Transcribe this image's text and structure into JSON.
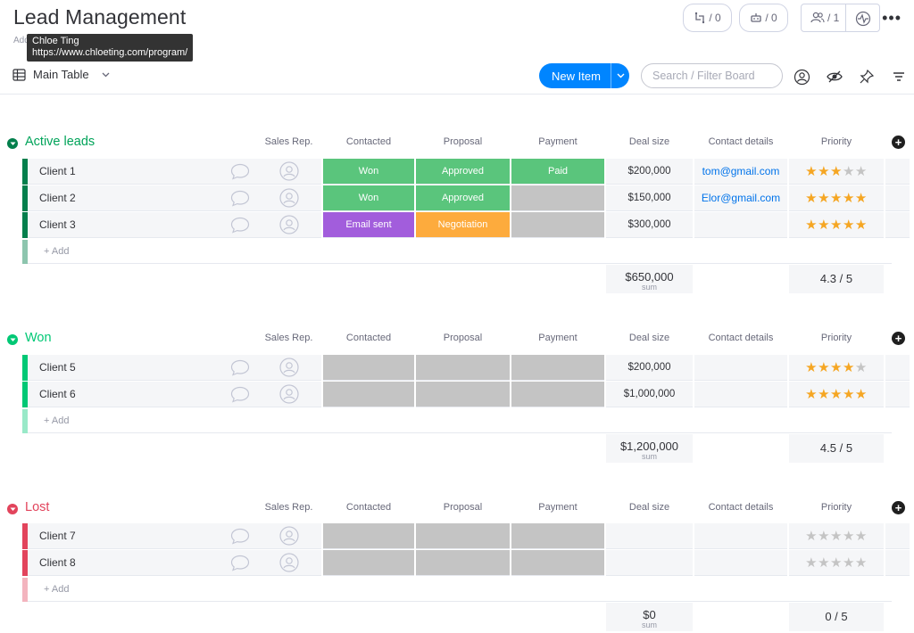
{
  "header": {
    "title": "Lead Management",
    "subtitle": "Add",
    "tooltip_name": "Chloe Ting",
    "tooltip_url": "https://www.chloeting.com/program/",
    "integrations_count": "/ 0",
    "automations_count": "/ 0",
    "members_count": "/ 1",
    "more": "•••"
  },
  "toolbar": {
    "view_label": "Main Table",
    "new_item_label": "New Item",
    "search_placeholder": "Search / Filter Board"
  },
  "columns": {
    "sales_rep": "Sales Rep.",
    "contacted": "Contacted",
    "proposal": "Proposal",
    "payment": "Payment",
    "deal_size": "Deal size",
    "contact_details": "Contact details",
    "priority": "Priority"
  },
  "add_label": "+ Add",
  "sum_label": "sum",
  "colors": {
    "active": "#037f4c",
    "active_title": "#00a359",
    "won": "#00c875",
    "lost": "#e2445c",
    "status_green": "#5ac57c",
    "status_purple": "#a25ddc",
    "status_orange": "#fdab3d",
    "status_empty": "#c4c4c4"
  },
  "groups": [
    {
      "title": "Active leads",
      "rows": [
        {
          "name": "Client 1",
          "contacted": "Won",
          "proposal": "Approved",
          "payment": "Paid",
          "deal": "$200,000",
          "email": "tom@gmail.com",
          "stars": 3
        },
        {
          "name": "Client 2",
          "contacted": "Won",
          "proposal": "Approved",
          "payment": "",
          "deal": "$150,000",
          "email": "Elor@gmail.com",
          "stars": 5
        },
        {
          "name": "Client 3",
          "contacted": "Email sent",
          "proposal": "Negotiation",
          "payment": "",
          "deal": "$300,000",
          "email": "",
          "stars": 5
        }
      ],
      "sum": "$650,000",
      "priority_avg": "4.3 / 5"
    },
    {
      "title": "Won",
      "rows": [
        {
          "name": "Client 5",
          "contacted": "",
          "proposal": "",
          "payment": "",
          "deal": "$200,000",
          "email": "",
          "stars": 4
        },
        {
          "name": "Client 6",
          "contacted": "",
          "proposal": "",
          "payment": "",
          "deal": "$1,000,000",
          "email": "",
          "stars": 5
        }
      ],
      "sum": "$1,200,000",
      "priority_avg": "4.5 / 5"
    },
    {
      "title": "Lost",
      "rows": [
        {
          "name": "Client 7",
          "contacted": "",
          "proposal": "",
          "payment": "",
          "deal": "",
          "email": "",
          "stars": 0
        },
        {
          "name": "Client 8",
          "contacted": "",
          "proposal": "",
          "payment": "",
          "deal": "",
          "email": "",
          "stars": 0
        }
      ],
      "sum": "$0",
      "priority_avg": "0 / 5"
    }
  ]
}
